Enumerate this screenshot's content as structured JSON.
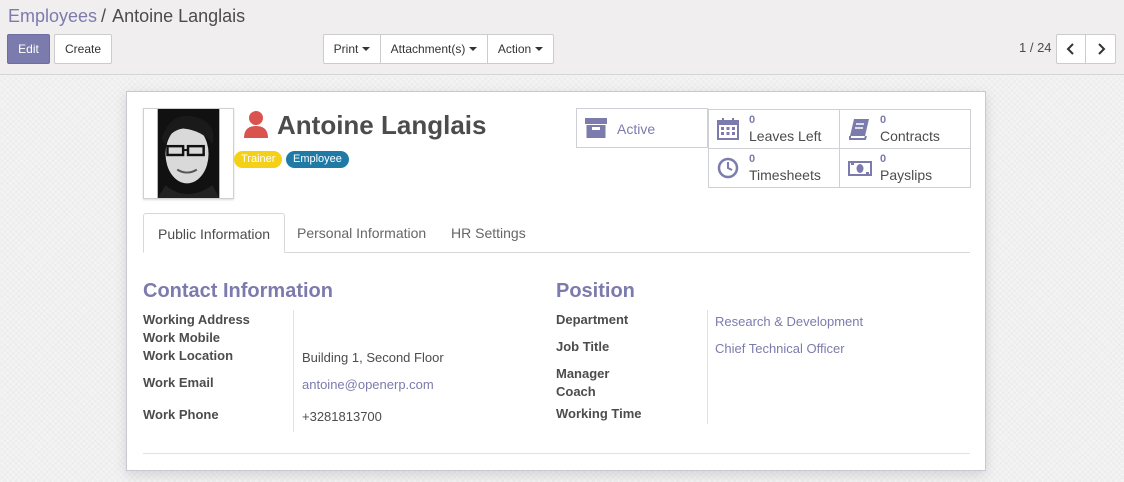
{
  "breadcrumb": {
    "parent": "Employees",
    "separator": "/",
    "current": "Antoine Langlais"
  },
  "toolbar": {
    "edit_label": "Edit",
    "create_label": "Create",
    "print_label": "Print",
    "attachments_label": "Attachment(s)",
    "action_label": "Action"
  },
  "pager": {
    "value": "1 / 24"
  },
  "employee": {
    "name": "Antoine Langlais",
    "tags": [
      "Trainer",
      "Employee"
    ]
  },
  "buttons": {
    "active": {
      "label": "Active",
      "icon": "archive-icon"
    },
    "leaves": {
      "count": "0",
      "label": "Leaves Left",
      "icon": "calendar-icon"
    },
    "contracts": {
      "count": "0",
      "label": "Contracts",
      "icon": "book-icon"
    },
    "timesheets": {
      "count": "0",
      "label": "Timesheets",
      "icon": "clock-icon"
    },
    "payslips": {
      "count": "0",
      "label": "Payslips",
      "icon": "money-icon"
    }
  },
  "tabs": [
    "Public Information",
    "Personal Information",
    "HR Settings"
  ],
  "contact": {
    "title": "Contact Information",
    "labels": {
      "working_address": "Working Address",
      "work_mobile": "Work Mobile",
      "work_location": "Work Location",
      "work_email": "Work Email",
      "work_phone": "Work Phone"
    },
    "values": {
      "work_location": "Building 1, Second Floor",
      "work_email": "antoine@openerp.com",
      "work_phone": "+3281813700"
    }
  },
  "position": {
    "title": "Position",
    "labels": {
      "department": "Department",
      "job_title": "Job Title",
      "manager": "Manager",
      "coach": "Coach",
      "working_time": "Working Time"
    },
    "values": {
      "department": "Research & Development",
      "job_title": "Chief Technical Officer"
    }
  },
  "colors": {
    "accent": "#7c7bad",
    "trainer_tag": "#f4d017",
    "employee_tag": "#1f7aa6",
    "employee_icon": "#d9534f"
  }
}
